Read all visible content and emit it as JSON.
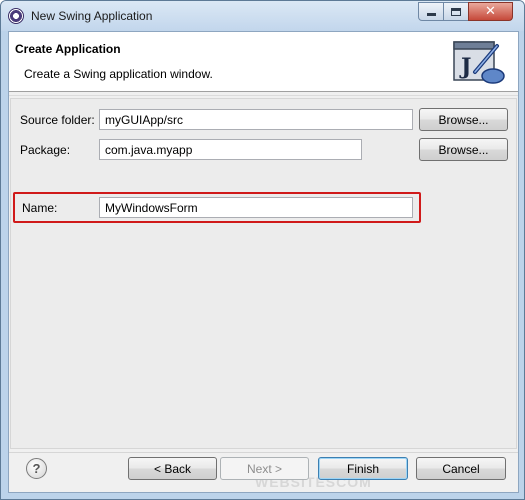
{
  "window": {
    "title": "New Swing Application"
  },
  "header": {
    "title": "Create Application",
    "description": "Create a Swing application window."
  },
  "form": {
    "source_folder": {
      "label": "Source folder:",
      "value": "myGUIApp/src",
      "browse_label": "Browse..."
    },
    "package": {
      "label": "Package:",
      "value": "com.java.myapp",
      "browse_label": "Browse..."
    },
    "name": {
      "label": "Name:",
      "value": "MyWindowsForm"
    }
  },
  "footer": {
    "help": "?",
    "back_label": "< Back",
    "next_label": "Next >",
    "finish_label": "Finish",
    "cancel_label": "Cancel",
    "watermark": "WEBSITESCOM"
  },
  "colors": {
    "highlight": "#d01a1a",
    "title_bar": "#c2d6ec",
    "close_button": "#c6493a"
  },
  "icons": [
    "app-icon",
    "java-wizard-icon",
    "help-icon"
  ]
}
